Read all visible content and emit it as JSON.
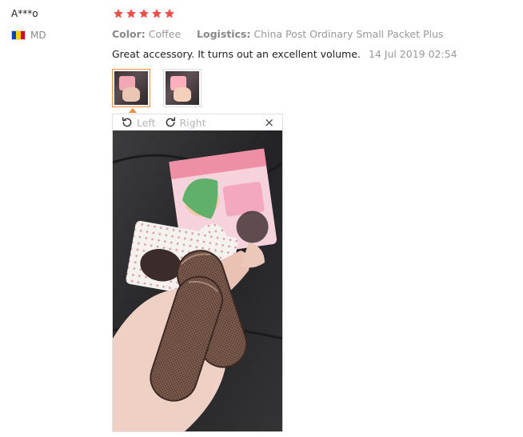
{
  "reviewer": {
    "name": "A***o",
    "country_code": "MD"
  },
  "rating": {
    "stars": 5,
    "max": 5,
    "star_color": "#e8504b"
  },
  "attributes": [
    {
      "label": "Color:",
      "value": "Coffee"
    },
    {
      "label": "Logistics:",
      "value": "China Post Ordinary Small Packet Plus"
    }
  ],
  "feedback": {
    "text": "Great accessory. It turns out an excellent volume.",
    "date": "14 Jul 2019 02:54"
  },
  "viewer": {
    "rotate_left_label": "Left",
    "rotate_right_label": "Right",
    "close_label": "×",
    "selected_image": 1,
    "image_count": 2
  },
  "colors": {
    "accent": "#f08c3c",
    "meta_text": "#999999"
  }
}
